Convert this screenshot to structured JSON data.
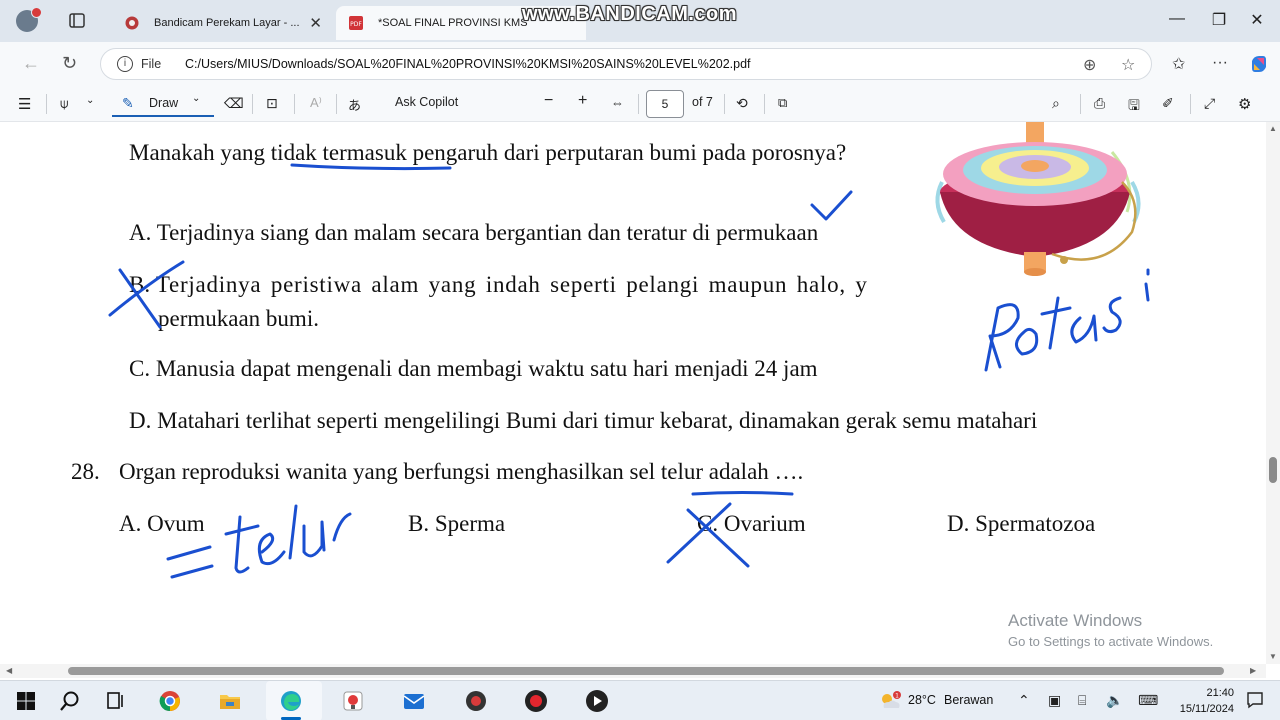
{
  "browser": {
    "tabs": [
      {
        "title": "Bandicam Perekam Layar - ..."
      },
      {
        "title": "*SOAL FINAL PROVINSI KMSI..."
      }
    ],
    "watermark": "www.BANDICAM.com",
    "address": {
      "scheme": "File",
      "url": "C:/Users/MIUS/Downloads/SOAL%20FINAL%20PROVINSI%20KMSI%20SAINS%20LEVEL%202.pdf"
    }
  },
  "pdf_toolbar": {
    "draw_label": "Draw",
    "copilot_label": "Ask Copilot",
    "page_current": "5",
    "page_total": "of 7"
  },
  "document": {
    "question_text": "Manakah yang tidak termasuk pengaruh dari perputaran bumi pada porosnya?",
    "options": [
      {
        "letter": "A.",
        "text": "Terjadinya siang dan malam secara bergantian dan teratur di permukaan"
      },
      {
        "letter": "B.",
        "text_line1": "Terjadinya peristiwa alam yang indah seperti pelangi maupun halo, y",
        "text_line2": "permukaan bumi."
      },
      {
        "letter": "C.",
        "text": "Manusia dapat mengenali dan membagi waktu satu hari menjadi 24 jam"
      },
      {
        "letter": "D.",
        "text": "Matahari terlihat seperti mengelilingi Bumi dari timur kebarat, dinamakan gerak semu matahari"
      }
    ],
    "q28": {
      "number": "28.",
      "text": "Organ reproduksi wanita yang berfungsi menghasilkan sel telur adalah ….",
      "answers": [
        "A. Ovum",
        "B. Sperma",
        "C. Ovarium",
        "D. Spermatozoa"
      ]
    },
    "annotations": {
      "rotasi": "Rotasi",
      "telur": "=telur"
    }
  },
  "activation": {
    "title": "Activate Windows",
    "subtitle": "Go to Settings to activate Windows."
  },
  "taskbar": {
    "weather_temp": "28°C",
    "weather_desc": "Berawan",
    "time": "21:40",
    "date": "15/11/2024"
  },
  "colors": {
    "ink": "#1a4fd0",
    "accent": "#0067c0"
  }
}
